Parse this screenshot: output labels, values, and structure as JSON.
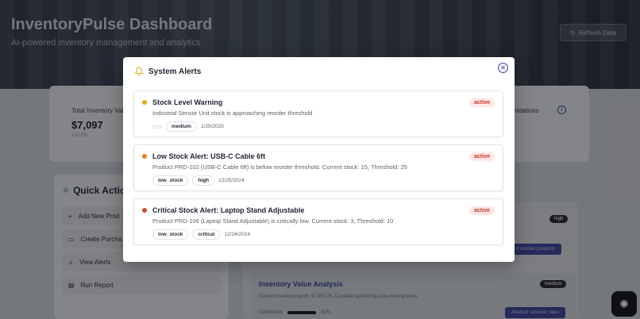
{
  "header": {
    "title": "InventoryPulse Dashboard",
    "subtitle": "AI-powered inventory management and analytics",
    "refresh_label": "Refresh Data"
  },
  "stats": {
    "total_label": "Total Inventory Val",
    "total_value": "$7,097",
    "total_note": "+12.5%",
    "recommendations_label": "endations"
  },
  "quick_actions": {
    "title": "Quick Actio",
    "items": [
      {
        "label": "Add New Prod",
        "icon": "plus-icon"
      },
      {
        "label": "Create Purcha",
        "icon": "document-icon"
      },
      {
        "label": "View Alerts",
        "icon": "bell-icon"
      },
      {
        "label": "Run Report",
        "icon": "chart-icon"
      }
    ]
  },
  "insights": {
    "badge_high": "high",
    "reorder_button": "d reorder products",
    "inventory_title": "Inventory Value Analysis",
    "inventory_badge": "medium",
    "inventory_text": "Current inventory worth: $7,097.25. Consider optimizing slow-moving items.",
    "confidence_label": "Confidence",
    "confidence_value": "82%",
    "confidence": 0.82,
    "analyze_button": "Analyze turnover rates"
  },
  "modal": {
    "title": "System Alerts",
    "alerts": [
      {
        "title": "Stock Level Warning",
        "description": "Industrial Sensor Unit stock is approaching reorder threshold",
        "status": "active",
        "type": "",
        "severity": "medium",
        "date": "1/25/2025",
        "dot_color": "#e6a817"
      },
      {
        "title": "Low Stock Alert: USB-C Cable 6ft",
        "description": "Product PRD-102 (USB-C Cable 6ft) is below reorder threshold. Current stock: 15, Threshold: 25",
        "status": "active",
        "type": "low_stock",
        "severity": "high",
        "date": "12/25/2024",
        "dot_color": "#e67e22"
      },
      {
        "title": "Critical Stock Alert: Laptop Stand Adjustable",
        "description": "Product PRD-106 (Laptop Stand Adjustable) is critically low. Current stock: 3, Threshold: 10",
        "status": "active",
        "type": "low_stock",
        "severity": "critical",
        "date": "12/24/2024",
        "dot_color": "#d9442f"
      }
    ]
  },
  "colors": {
    "accent": "#3b4fa0",
    "status_active": "#c0392b"
  }
}
